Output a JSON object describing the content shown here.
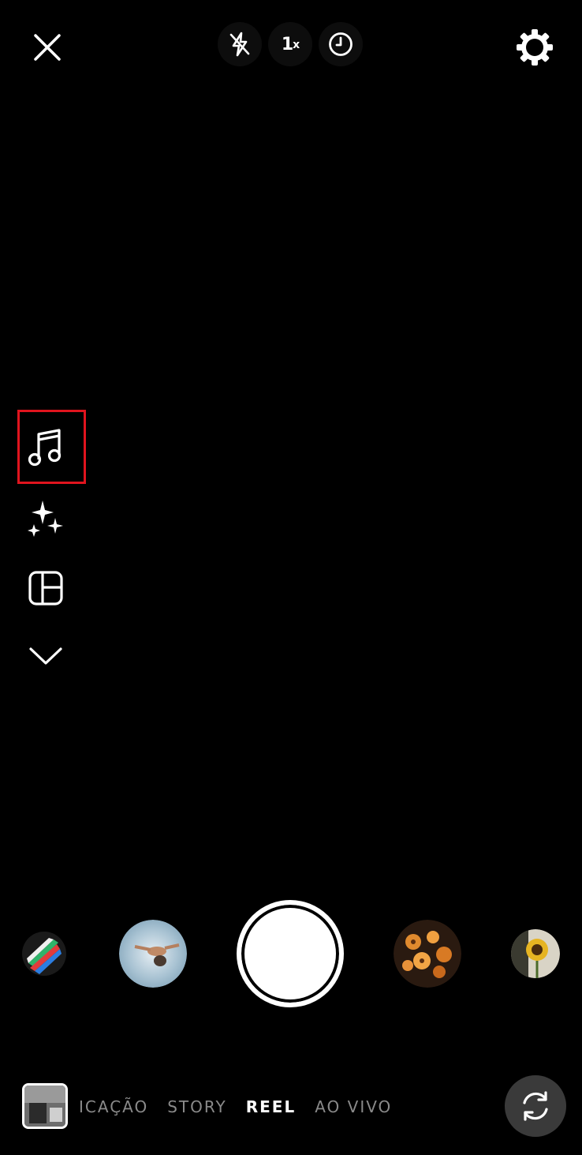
{
  "top_bar": {
    "close_icon": "close-icon",
    "flash_icon": "flash-off-icon",
    "zoom_value": "1",
    "zoom_suffix": "x",
    "timer_icon": "timer-icon",
    "settings_icon": "settings-gear-icon"
  },
  "side_tools": {
    "items": [
      {
        "icon": "music-note-icon",
        "highlighted": true
      },
      {
        "icon": "sparkles-effects-icon"
      },
      {
        "icon": "layout-grid-icon"
      },
      {
        "icon": "chevron-down-icon"
      }
    ],
    "highlight_color": "#e0141e"
  },
  "effects_carousel": {
    "items": [
      {
        "name": "effect-colorful-stripes"
      },
      {
        "name": "effect-person-water-photo"
      },
      {
        "name": "shutter"
      },
      {
        "name": "effect-orange-flowers-photo"
      },
      {
        "name": "effect-sunflower-photo"
      }
    ]
  },
  "bottom_bar": {
    "modes": [
      "ICAÇÃO",
      "STORY",
      "REEL",
      "AO VIVO"
    ],
    "active_mode": "REEL",
    "gallery_icon": "gallery-thumbnail",
    "flip_camera_icon": "flip-camera-icon"
  }
}
